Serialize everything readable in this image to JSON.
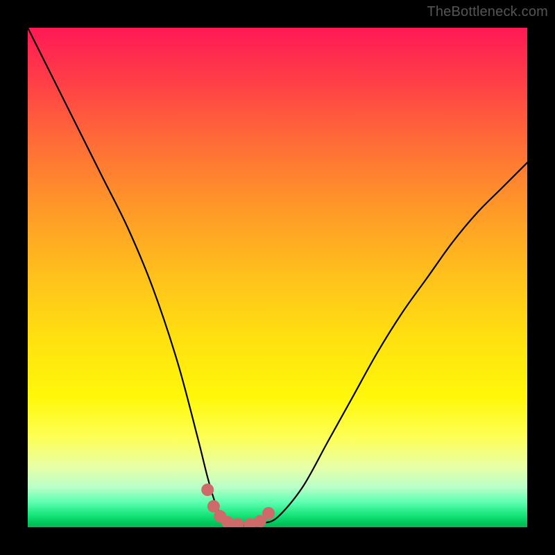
{
  "watermark": {
    "text": "TheBottleneck.com"
  },
  "colors": {
    "frame": "#000000",
    "curve": "#000000",
    "markers": "#cf6a6a",
    "gradient_top": "#ff1955",
    "gradient_bottom": "#00b84e"
  },
  "chart_data": {
    "type": "line",
    "title": "",
    "xlabel": "",
    "ylabel": "",
    "xlim": [
      0,
      100
    ],
    "ylim": [
      0,
      100
    ],
    "grid": false,
    "legend": false,
    "series": [
      {
        "name": "bottleneck-curve",
        "x": [
          0,
          5,
          10,
          15,
          20,
          25,
          30,
          34,
          36,
          37.5,
          39,
          41,
          43,
          45,
          47,
          50,
          55,
          60,
          65,
          70,
          75,
          80,
          85,
          90,
          95,
          100
        ],
        "values": [
          100,
          90,
          80,
          70,
          60,
          48,
          33,
          18,
          10,
          5,
          2,
          0.8,
          0.5,
          0.5,
          0.8,
          2,
          8,
          17,
          26,
          35,
          43,
          50,
          57,
          63,
          68,
          73
        ]
      }
    ],
    "markers": {
      "name": "bottleneck-valley-points",
      "x": [
        36,
        37.2,
        38.5,
        40,
        42,
        44.5,
        46.5,
        48.2
      ],
      "values": [
        7.5,
        4.2,
        2.2,
        1.0,
        0.6,
        0.6,
        1.2,
        2.8
      ]
    }
  }
}
